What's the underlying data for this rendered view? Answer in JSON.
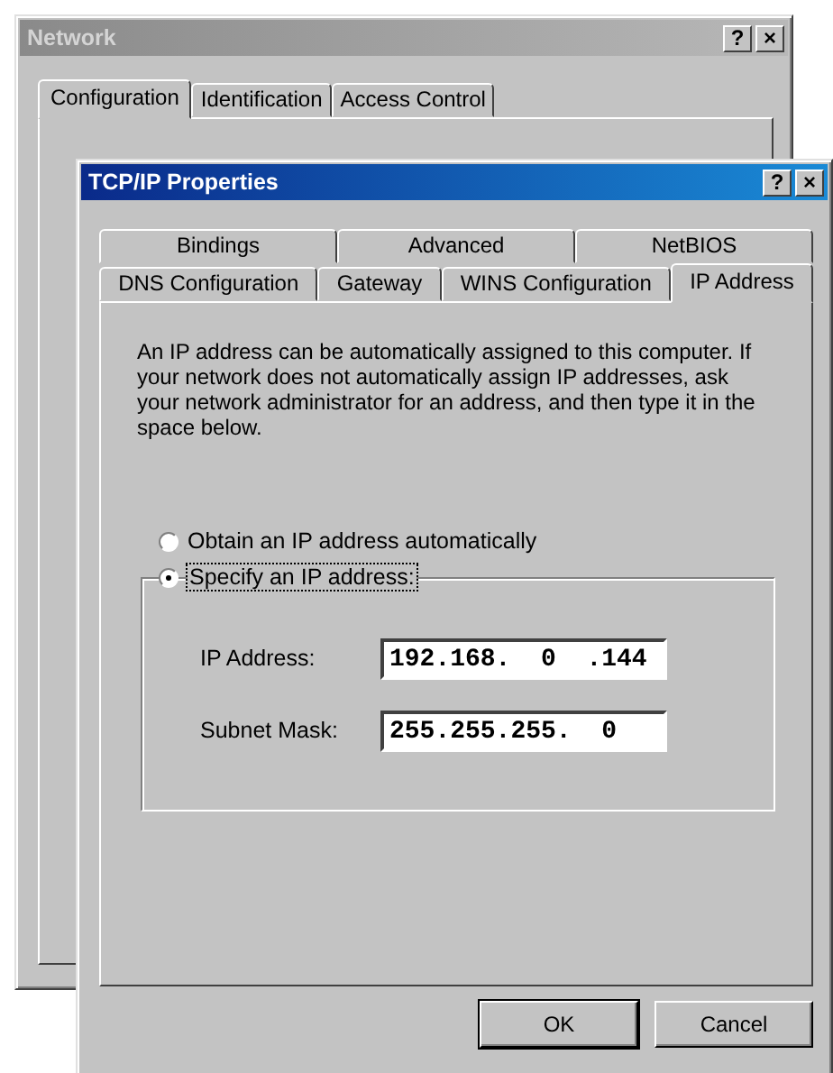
{
  "network_window": {
    "title": "Network",
    "active": false,
    "title_buttons": [
      "?",
      "×"
    ],
    "tabs": [
      {
        "label": "Configuration",
        "selected": true
      },
      {
        "label": "Identification",
        "selected": false
      },
      {
        "label": "Access Control",
        "selected": false
      }
    ]
  },
  "tcpip_window": {
    "title": "TCP/IP Properties",
    "active": true,
    "title_buttons": [
      "?",
      "×"
    ],
    "tabs_back_row": [
      {
        "label": "Bindings",
        "selected": false
      },
      {
        "label": "Advanced",
        "selected": false
      },
      {
        "label": "NetBIOS",
        "selected": false
      }
    ],
    "tabs_front_row": [
      {
        "label": "DNS Configuration",
        "selected": false
      },
      {
        "label": "Gateway",
        "selected": false
      },
      {
        "label": "WINS Configuration",
        "selected": false
      },
      {
        "label": "IP Address",
        "selected": true
      }
    ],
    "description": "An IP address can be automatically assigned to this computer. If your network does not automatically assign IP addresses, ask your network administrator for an address, and then type it in the space below.",
    "options": [
      {
        "label": "Obtain an IP address automatically",
        "selected": false
      },
      {
        "label": "Specify an IP address:",
        "selected": true
      }
    ],
    "fields": [
      {
        "label": "IP Address:",
        "value": "192.168.  0  .144"
      },
      {
        "label": "Subnet Mask:",
        "value": "255.255.255.  0"
      }
    ],
    "buttons": [
      "OK",
      "Cancel"
    ]
  }
}
